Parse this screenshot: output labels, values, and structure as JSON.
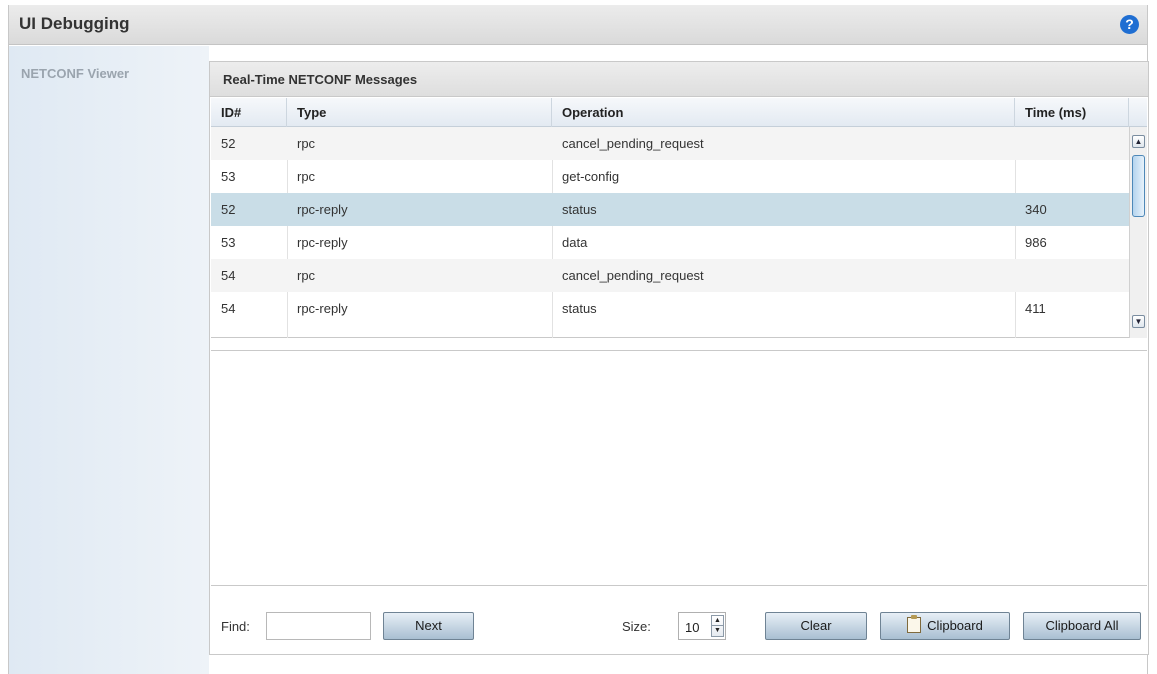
{
  "window": {
    "title": "UI Debugging",
    "help_icon": "help-icon",
    "help_glyph": "?"
  },
  "sidebar": {
    "items": [
      {
        "label": "NETCONF Viewer"
      }
    ]
  },
  "panel": {
    "title": "Real-Time NETCONF Messages"
  },
  "table": {
    "columns": [
      "ID#",
      "Type",
      "Operation",
      "Time (ms)"
    ],
    "selected_row_index": 2,
    "rows": [
      {
        "id": "52",
        "type": "rpc",
        "operation": "cancel_pending_request",
        "time": ""
      },
      {
        "id": "53",
        "type": "rpc",
        "operation": "get-config",
        "time": ""
      },
      {
        "id": "52",
        "type": "rpc-reply",
        "operation": "status",
        "time": "340"
      },
      {
        "id": "53",
        "type": "rpc-reply",
        "operation": "data",
        "time": "986"
      },
      {
        "id": "54",
        "type": "rpc",
        "operation": "cancel_pending_request",
        "time": ""
      },
      {
        "id": "54",
        "type": "rpc-reply",
        "operation": "status",
        "time": "411"
      }
    ]
  },
  "footer": {
    "find_label": "Find:",
    "find_value": "",
    "next_label": "Next",
    "size_label": "Size:",
    "size_value": "10",
    "clear_label": "Clear",
    "clipboard_label": "Clipboard",
    "clipboard_all_label": "Clipboard All"
  },
  "colors": {
    "help_icon": "#1f6ed2",
    "selected_row": "#c9dde7",
    "sidebar": "#e6eef6"
  }
}
